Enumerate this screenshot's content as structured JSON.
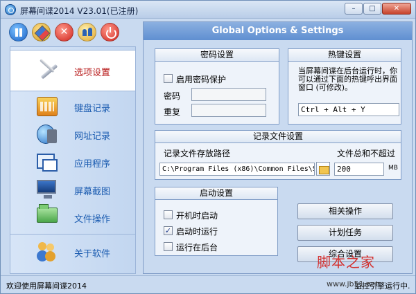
{
  "window": {
    "title": "屏幕间谍2014 V23.01(已注册)",
    "buttons": [
      "–",
      "□",
      "✕"
    ]
  },
  "toolbar": {
    "icons": [
      "pause-icon",
      "tools-icon",
      "stop-icon",
      "users-icon",
      "power-icon"
    ]
  },
  "sidebar": {
    "items": [
      {
        "label": "选项设置",
        "icon": "wrench-icon",
        "active": true
      },
      {
        "label": "键盘记录",
        "icon": "keyboard-icon"
      },
      {
        "label": "网址记录",
        "icon": "globe-icon"
      },
      {
        "label": "应用程序",
        "icon": "app-window-icon"
      },
      {
        "label": "屏幕截图",
        "icon": "monitor-icon"
      },
      {
        "label": "文件操作",
        "icon": "folder-icon"
      },
      {
        "label": "关于软件",
        "icon": "people-icon"
      }
    ]
  },
  "main": {
    "header": "Global Options & Settings",
    "password": {
      "title": "密码设置",
      "enable_label": "启用密码保护",
      "password_label": "密码",
      "password_value": "",
      "repeat_label": "重复",
      "repeat_value": ""
    },
    "hotkey": {
      "title": "热键设置",
      "description": "当屏幕间谍在后台运行时，你可以通过下面的热键呼出界面窗口 (可修改)。",
      "value": "Ctrl + Alt + Y"
    },
    "logfile": {
      "title": "记录文件设置",
      "path_label": "记录文件存放路径",
      "path_value": "C:\\Program Files (x86)\\Common Files\\Sy",
      "size_label": "文件总和不超过",
      "size_value": "200",
      "size_unit": "MB"
    },
    "startup": {
      "title": "启动设置",
      "options": [
        {
          "label": "开机时启动",
          "checked": false
        },
        {
          "label": "启动时运行",
          "checked": true
        },
        {
          "label": "运行在后台",
          "checked": false
        }
      ]
    },
    "actions": {
      "related": "相关操作",
      "schedule": "计划任务",
      "general": "综合设置"
    }
  },
  "status": {
    "text": "欢迎使用屏幕间谍2014",
    "right": "监控引擎运行中."
  },
  "watermark": {
    "logo": "脚本之家",
    "sub": "www.jb51.net"
  },
  "colors": {
    "accent_red": "#b81c1c",
    "nav_text": "#1a5bb0",
    "header_blue": "#5f8fd1"
  }
}
